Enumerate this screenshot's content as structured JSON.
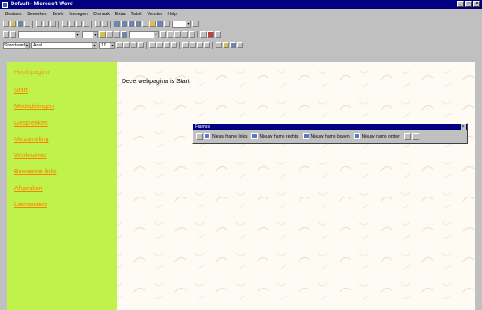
{
  "window": {
    "title": "Default - Microsoft Word"
  },
  "menu": [
    "Bestand",
    "Bewerken",
    "Beeld",
    "Invoegen",
    "Opmaak",
    "Extra",
    "Tabel",
    "Venster",
    "Help"
  ],
  "format_toolbar": {
    "style": "Standaard",
    "font": "Arial",
    "size": "10"
  },
  "sidebar_links": [
    "Hoofdpagina",
    "Start",
    "Mededelingen",
    "Gesprekken",
    "Verzameling",
    "Werkruimte",
    "Bewaarde links",
    "Afspraken",
    "Lesroosters"
  ],
  "document": {
    "body_text": "Deze webpagina is Start"
  },
  "frames_toolbar": {
    "title": "Frames",
    "buttons": [
      "Nieuw frame links",
      "Nieuw frame rechts",
      "Nieuw frame boven",
      "Nieuw frame onder"
    ]
  }
}
